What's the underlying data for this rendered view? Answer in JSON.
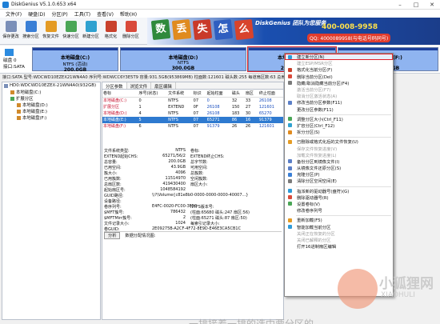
{
  "window": {
    "title": "DiskGenius V5.1.0.653 x64",
    "buttons": [
      "–",
      "□",
      "✕"
    ]
  },
  "menubar": [
    "文件(F)",
    "硬盘(D)",
    "分区(P)",
    "工具(T)",
    "查看(V)",
    "帮助(H)"
  ],
  "toolbar": [
    {
      "label": "保存更改",
      "color": "#7a8fb8"
    },
    {
      "label": "搜索分区",
      "color": "#3a7fd6"
    },
    {
      "label": "恢复文件",
      "color": "#e49b24"
    },
    {
      "label": "快速分区",
      "color": "#4aa657"
    },
    {
      "label": "新建分区",
      "color": "#2fa1d0"
    },
    {
      "label": "格式化",
      "color": "#c9412c"
    },
    {
      "label": "删除分区",
      "color": "#d94a3b"
    },
    {
      "label": "备份分区",
      "color": "#5b7fc7"
    }
  ],
  "banner": {
    "tiles": [
      {
        "char": "数",
        "color": "#2f8a3c"
      },
      {
        "char": "丢",
        "color": "#e08b1f"
      },
      {
        "char": "失",
        "color": "#c93a2a"
      },
      {
        "char": "怎",
        "color": "#2f5ec0"
      },
      {
        "char": "么",
        "color": "#d8432c"
      }
    ],
    "slogan": "DiskGenius 团队为您服务",
    "phone": "400-008-9958",
    "qq": "QQ: 4000089958(与电话号码同号)"
  },
  "disk_map": {
    "label1": "磁盘 0",
    "label2": "接口:SATA",
    "partitions": [
      {
        "name": "本地磁盘(C:)",
        "fs": "NTFS (活动)",
        "size": "200.0GB",
        "color": "#3a6fd8"
      },
      {
        "name": "本地磁盘(D:)",
        "fs": "NTFS",
        "size": "300.0GB",
        "color": "#3a6fd8"
      },
      {
        "name": "本地磁盘(E:)",
        "fs": "NTFS",
        "size": "200.0GB",
        "color": "#3a6fd8"
      },
      {
        "name": "本地磁盘(F:)",
        "fs": "NTFS",
        "size": "232.0GB",
        "color": "#3a6fd8"
      }
    ]
  },
  "statusline": "接口:SATA  型号:WDCWD10EZEX21WN4A0  序列号:WDWCC6Y3E5T9  容量:931.5GB(953869MB)  柱面数:121601  磁头数:255  每道扇区数:63  总扇区数:1953525168",
  "tree": [
    "HD0:WDCWD10EZEX-21WN4A0(932GB)",
    "本地磁盘(C:)",
    "扩展分区",
    "本地磁盘(D:)",
    "本地磁盘(E:)",
    "本地磁盘(F:)"
  ],
  "tabs": [
    "分区参数",
    "浏览文件",
    "扇区编辑"
  ],
  "table": {
    "headers": [
      "卷标",
      "序号(状态)",
      "文件系统",
      "标识",
      "起始柱面",
      "磁头",
      "扇区",
      "终止柱面"
    ],
    "rows": [
      {
        "cells": [
          "本地磁盘(C:)",
          "0",
          "NTFS",
          "07",
          "0",
          "32",
          "33",
          "26108"
        ],
        "sel": false
      },
      {
        "cells": [
          "扩展分区",
          "1",
          "EXTEND",
          "0F",
          "26108",
          "150",
          "27",
          "121601"
        ],
        "sel": false
      },
      {
        "cells": [
          "本地磁盘(D:)",
          "4",
          "NTFS",
          "07",
          "26108",
          "183",
          "30",
          "65270"
        ],
        "sel": false
      },
      {
        "cells": [
          "本地磁盘(E:)",
          "5",
          "NTFS",
          "07",
          "65271",
          "86",
          "16",
          "91379"
        ],
        "sel": true
      },
      {
        "cells": [
          "本地磁盘(F:)",
          "6",
          "NTFS",
          "07",
          "91379",
          "26",
          "26",
          "121601"
        ],
        "sel": false
      }
    ]
  },
  "info": [
    {
      "k": "文件系统类型:",
      "v": "NTFS",
      "k2": "卷标:",
      "v2": ""
    },
    {
      "k": "EXTEND起始CHS:",
      "v": "65271/56/2",
      "k2": "EXTEND终止CHS:",
      "v2": ""
    },
    {
      "k": "总容量:",
      "v": "200.0GB",
      "k2": "总字节数:",
      "v2": ""
    },
    {
      "k": "已用空间:",
      "v": "43.9GB",
      "k2": "可用空间:",
      "v2": ""
    },
    {
      "k": "簇大小:",
      "v": "4096",
      "k2": "总簇数:",
      "v2": ""
    },
    {
      "k": "已用簇数:",
      "v": "11514970",
      "k2": "空闲簇数:",
      "v2": ""
    },
    {
      "k": "总扇区数:",
      "v": "419430400",
      "k2": "扇区大小:",
      "v2": ""
    },
    {
      "k": "起始扇区号:",
      "v": "1048584192",
      "k2": "",
      "v2": ""
    },
    {
      "k": "GUID路径:",
      "v": "\\\\?\\Volume{c81e8b0-0000-0000-0000-40007...}",
      "k2": "",
      "v2": ""
    },
    {
      "k": "设备路径:",
      "v": "",
      "k2": "",
      "v2": ""
    },
    {
      "k": "卷序列号:",
      "v": "E4FC-0020-FC00-3F5C",
      "k2": "NTFS版本号:",
      "v2": ""
    },
    {
      "k": "$MFT簇号:",
      "v": "786432",
      "k2": "(柱面:65680 磁头:247 扇区:56)",
      "v2": ""
    },
    {
      "k": "$MFTMirr簇号:",
      "v": "2",
      "k2": "(柱面:65271 磁头:87 扇区:50)",
      "v2": ""
    },
    {
      "k": "文件记录大小:",
      "v": "1024",
      "k2": "每索引记录大小:",
      "v2": ""
    },
    {
      "k": "卷GUID:",
      "v": "2E09275B-A2CF-4F72-8E9D-E46E3CA5CB1C",
      "k2": "",
      "v2": ""
    }
  ],
  "analyze": {
    "button": "分析",
    "label": "数据分配情况图:"
  },
  "context_menu": [
    {
      "label": "建立新分区(N)",
      "icon": "#2e9bd8",
      "disabled": false,
      "hl": true
    },
    {
      "label": "建立ESP/MSR分区",
      "icon": "",
      "disabled": true
    },
    {
      "label": "格式化当前分区(F)",
      "icon": "#c9412c",
      "disabled": false
    },
    {
      "label": "删除当前分区(Del)",
      "icon": "#d94a3b",
      "disabled": false
    },
    {
      "label": "隐藏/取消隐藏当前分区(F4)",
      "icon": "#7a7a7a",
      "disabled": false
    },
    {
      "label": "激活当前分区(F7)",
      "icon": "",
      "disabled": true
    },
    {
      "label": "取消分区激活状态(A)",
      "icon": "",
      "disabled": true
    },
    {
      "label": "修改当前分区参数(F11)",
      "icon": "#5b7fc7",
      "disabled": false
    },
    {
      "label": "更改分区参数(F11)",
      "icon": "",
      "disabled": false
    },
    {
      "sep": true
    },
    {
      "label": "调整分区大小(Ctrl_F11)",
      "icon": "#4aa657",
      "disabled": false
    },
    {
      "label": "扩容分区(Ctrl_F12)",
      "icon": "#2fa1d0",
      "disabled": false
    },
    {
      "label": "拆分分区(S)",
      "icon": "#e08b1f",
      "disabled": false
    },
    {
      "sep": true
    },
    {
      "label": "已删除或格式化后的文件恢复(U)",
      "icon": "#e49b24",
      "disabled": false
    },
    {
      "label": "保存文件恢复进度(V)",
      "icon": "",
      "disabled": true
    },
    {
      "label": "加载文件恢复进度(L)",
      "icon": "",
      "disabled": true
    },
    {
      "label": "备份分区到镜像文件(I)",
      "icon": "#5b7fc7",
      "disabled": false
    },
    {
      "label": "从镜像文件还原分区(S)",
      "icon": "#5b7fc7",
      "disabled": false
    },
    {
      "label": "克隆分区(P)",
      "icon": "#3a7fd6",
      "disabled": false
    },
    {
      "label": "清除分区空闲空间(E)",
      "icon": "#7a7a7a",
      "disabled": false
    },
    {
      "sep": true
    },
    {
      "label": "指派新的驱动器号(盘符)(G)",
      "icon": "#2e9bd8",
      "disabled": false
    },
    {
      "label": "删除驱动器号(R)",
      "icon": "#d94a3b",
      "disabled": false
    },
    {
      "label": "设置卷标(V)",
      "icon": "#4aa657",
      "disabled": false
    },
    {
      "label": "修改卷序列号",
      "icon": "",
      "disabled": false
    },
    {
      "sep": true
    },
    {
      "label": "重新加载(F5)",
      "icon": "#e49b24",
      "disabled": false
    },
    {
      "label": "智能加载当前分区",
      "icon": "#2e9bd8",
      "disabled": false
    },
    {
      "label": "关闭正在恢复的分区",
      "icon": "",
      "disabled": true
    },
    {
      "label": "关闭已解释的分区",
      "icon": "",
      "disabled": true
    },
    {
      "label": "打开16进制扇区编辑",
      "icon": "",
      "disabled": false
    }
  ],
  "watermark": {
    "text": "小狐狸网",
    "sub": "XIAOHULI"
  },
  "caption": "一排接着一排的选中要分区的"
}
